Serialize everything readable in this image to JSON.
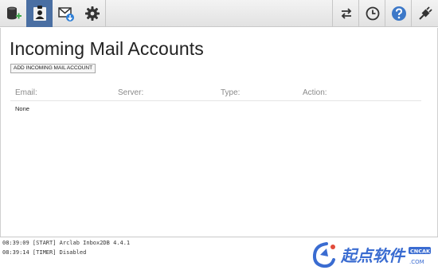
{
  "toolbar": {
    "left_icons": [
      "database-add-icon",
      "user-account-icon",
      "mail-download-icon",
      "gear-icon"
    ],
    "right_icons": [
      "transfer-arrows-icon",
      "clock-icon",
      "help-icon",
      "plug-icon"
    ],
    "active_color": "#4a6fa3",
    "help_color": "#3c78c8"
  },
  "main": {
    "title": "Incoming Mail Accounts",
    "add_button_label": "ADD INCOMING MAIL ACCOUNT",
    "columns": [
      "Email:",
      "Server:",
      "Type:",
      "Action:"
    ],
    "empty_text": "None"
  },
  "log": {
    "lines": [
      "08:39:09 [START] Arclab Inbox2DB 4.4.1",
      "08:39:14 [TIMER] Disabled"
    ]
  },
  "watermark": {
    "text": "起点软件",
    "small_text": "CNCAK",
    "color": "#3a6cd1"
  }
}
